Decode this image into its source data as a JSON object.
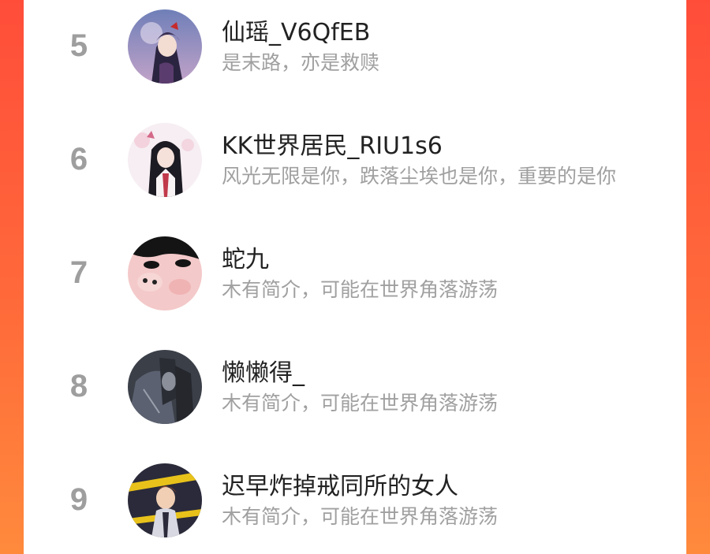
{
  "ranking": {
    "entries": [
      {
        "rank": "5",
        "name": "仙瑶_V6QfEB",
        "bio": "是末路，亦是救赎",
        "avatar": "anime-girl-sky-avatar"
      },
      {
        "rank": "6",
        "name": "KK世界居民_RIU1s6",
        "bio": "风光无限是你，跌落尘埃也是你，重要的是你",
        "avatar": "anime-girl-hanfu-avatar"
      },
      {
        "rank": "7",
        "name": "蛇九",
        "bio": "木有简介，可能在世界角落游荡",
        "avatar": "cartoon-face-avatar"
      },
      {
        "rank": "8",
        "name": "懒懒得_",
        "bio": "木有简介，可能在世界角落游荡",
        "avatar": "dark-anime-avatar"
      },
      {
        "rank": "9",
        "name": "迟早炸掉戒同所的女人",
        "bio": "木有简介，可能在世界角落游荡",
        "avatar": "anime-boy-caution-tape-avatar"
      }
    ]
  },
  "colors": {
    "background_gradient_top": "#ff4d3a",
    "background_gradient_bottom": "#ff8a3c",
    "rank_text": "#9e9e9e",
    "name_text": "#222222",
    "bio_text": "#a0a0a0"
  }
}
